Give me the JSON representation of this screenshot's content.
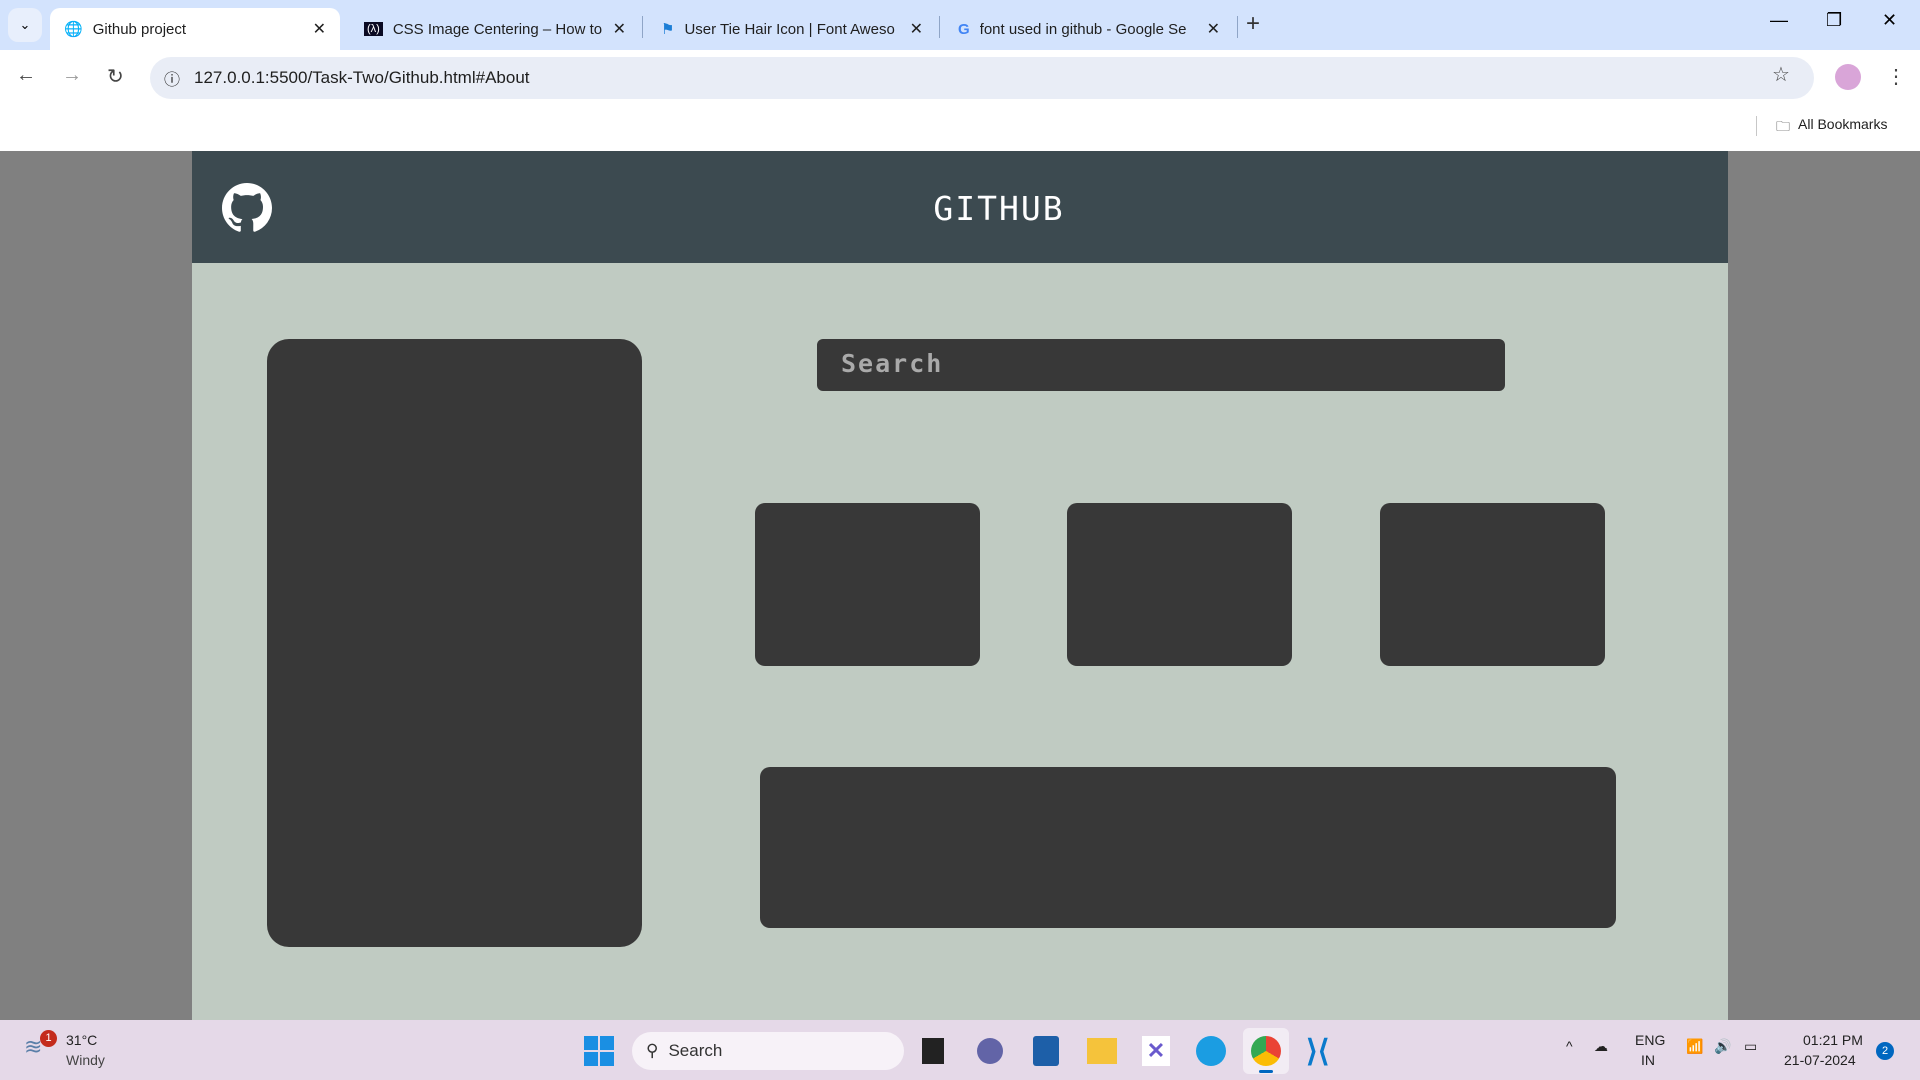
{
  "browser": {
    "tabs": [
      {
        "title": "Github project",
        "active": true
      },
      {
        "title": "CSS Image Centering – How to"
      },
      {
        "title": "User Tie Hair Icon | Font Aweso"
      },
      {
        "title": "font used in github - Google Se"
      }
    ],
    "url": "127.0.0.1:5500/Task-Two/Github.html#About",
    "bookmarks_label": "All Bookmarks"
  },
  "page": {
    "header_title": "GITHUB",
    "search_placeholder": "Search"
  },
  "taskbar": {
    "weather_temp": "31°C",
    "weather_desc": "Windy",
    "weather_badge": "1",
    "search_label": "Search",
    "lang_top": "ENG",
    "lang_bottom": "IN",
    "time": "01:21 PM",
    "date": "21-07-2024",
    "notification_count": "2"
  }
}
